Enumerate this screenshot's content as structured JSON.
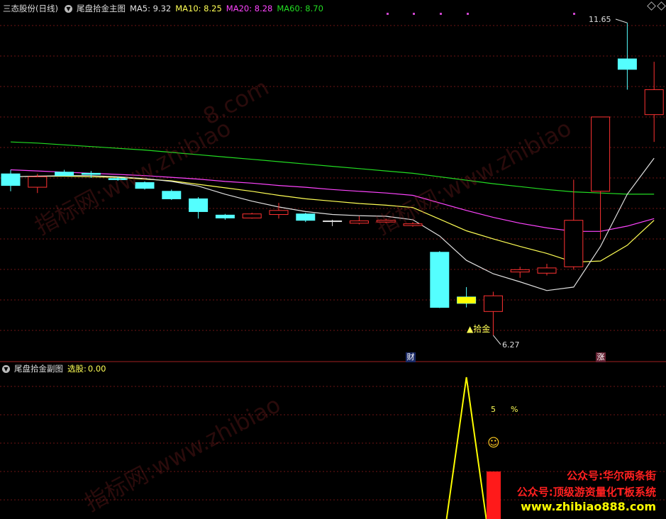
{
  "main_panel": {
    "stock_name": "三态股份",
    "period": "(日线)",
    "indicator_name": "尾盘拾金主图",
    "ma": [
      {
        "label": "MA5:",
        "value": "9.32",
        "color": "#e0e0e0"
      },
      {
        "label": "MA10:",
        "value": "8.25",
        "color": "#ffff55"
      },
      {
        "label": "MA20:",
        "value": "8.28",
        "color": "#ff44ff"
      },
      {
        "label": "MA60:",
        "value": "8.70",
        "color": "#22dd22"
      }
    ],
    "high_label": "11.65",
    "low_label": "6.27",
    "signal_label": "▲拾金",
    "event_markers": [
      "财",
      "涨"
    ]
  },
  "sub_panel": {
    "indicator_name": "尾盘拾金副图",
    "select_label": "选股:",
    "select_value": "0.00",
    "number_5": "5",
    "percent": "%",
    "smiley": "☺"
  },
  "watermark": {
    "cn": "指标网:",
    "url": "www.zhibiao",
    "url2": "8.com"
  },
  "promo": {
    "line1": "公众号:华尔两条街",
    "line2": "公众号:顶级游资量化T板系统",
    "line3": "www.zhibiao888.com"
  },
  "colors": {
    "up": "#ff3232",
    "down": "#54ffff",
    "flat": "#e0e0e0",
    "ma5": "#e0e0e0",
    "ma10": "#ffff55",
    "ma20": "#ff44ff",
    "ma60": "#22dd22",
    "grid": "#6e1515",
    "promo_red": "#ff2020",
    "promo_yellow": "#ffff00"
  },
  "chart_data": {
    "type": "candlestick",
    "candles": [
      {
        "o": 9.05,
        "h": 9.12,
        "l": 8.75,
        "c": 8.85
      },
      {
        "o": 8.82,
        "h": 9.05,
        "l": 8.72,
        "c": 9.0
      },
      {
        "o": 9.08,
        "h": 9.12,
        "l": 9.02,
        "c": 9.02
      },
      {
        "o": 9.06,
        "h": 9.1,
        "l": 8.98,
        "c": 9.04
      },
      {
        "o": 8.97,
        "h": 9.0,
        "l": 8.93,
        "c": 8.95
      },
      {
        "o": 8.9,
        "h": 8.92,
        "l": 8.78,
        "c": 8.8
      },
      {
        "o": 8.75,
        "h": 8.78,
        "l": 8.6,
        "c": 8.62
      },
      {
        "o": 8.62,
        "h": 8.65,
        "l": 8.28,
        "c": 8.4
      },
      {
        "o": 8.34,
        "h": 8.36,
        "l": 8.26,
        "c": 8.29
      },
      {
        "o": 8.29,
        "h": 8.38,
        "l": 8.28,
        "c": 8.36
      },
      {
        "o": 8.35,
        "h": 8.55,
        "l": 8.28,
        "c": 8.42
      },
      {
        "o": 8.36,
        "h": 8.38,
        "l": 8.22,
        "c": 8.25
      },
      {
        "o": 8.24,
        "h": 8.26,
        "l": 8.15,
        "c": 8.24
      },
      {
        "o": 8.2,
        "h": 8.32,
        "l": 8.18,
        "c": 8.24
      },
      {
        "o": 8.22,
        "h": 8.28,
        "l": 8.2,
        "c": 8.25
      },
      {
        "o": 8.16,
        "h": 8.22,
        "l": 8.14,
        "c": 8.19
      },
      {
        "o": 7.7,
        "h": 7.72,
        "l": 6.74,
        "c": 6.75
      },
      {
        "o": 6.93,
        "h": 7.1,
        "l": 6.75,
        "c": 6.82
      },
      {
        "o": 6.68,
        "h": 7.02,
        "l": 6.27,
        "c": 6.95
      },
      {
        "o": 7.36,
        "h": 7.45,
        "l": 7.26,
        "c": 7.4
      },
      {
        "o": 7.34,
        "h": 7.5,
        "l": 7.3,
        "c": 7.43
      },
      {
        "o": 7.45,
        "h": 8.95,
        "l": 7.4,
        "c": 8.25
      },
      {
        "o": 8.75,
        "h": 10.03,
        "l": 7.92,
        "c": 10.03
      },
      {
        "o": 11.03,
        "h": 11.65,
        "l": 10.5,
        "c": 10.85
      },
      {
        "o": 10.07,
        "h": 10.98,
        "l": 9.6,
        "c": 10.5
      }
    ],
    "ma5": [
      9.0,
      9.01,
      9.02,
      9.02,
      9.0,
      8.97,
      8.92,
      8.84,
      8.7,
      8.58,
      8.48,
      8.4,
      8.35,
      8.33,
      8.32,
      8.26,
      7.98,
      7.56,
      7.33,
      7.19,
      7.04,
      7.1,
      7.8,
      8.7,
      9.32
    ],
    "ma10": [
      9.0,
      9.01,
      9.01,
      9.0,
      8.99,
      8.96,
      8.93,
      8.87,
      8.81,
      8.75,
      8.68,
      8.62,
      8.58,
      8.54,
      8.51,
      8.47,
      8.27,
      8.07,
      7.93,
      7.8,
      7.68,
      7.53,
      7.55,
      7.82,
      8.25
    ],
    "ma20": [
      9.12,
      9.1,
      9.08,
      9.06,
      9.04,
      9.02,
      8.99,
      8.96,
      8.92,
      8.89,
      8.85,
      8.82,
      8.78,
      8.75,
      8.72,
      8.68,
      8.55,
      8.42,
      8.3,
      8.2,
      8.12,
      8.06,
      8.06,
      8.15,
      8.28
    ],
    "ma60": [
      9.6,
      9.58,
      9.55,
      9.52,
      9.49,
      9.46,
      9.42,
      9.38,
      9.34,
      9.3,
      9.26,
      9.22,
      9.18,
      9.14,
      9.1,
      9.06,
      9.0,
      8.94,
      8.88,
      8.83,
      8.78,
      8.74,
      8.72,
      8.7,
      8.7
    ],
    "sub_series": [
      0,
      0,
      0,
      0,
      0,
      0,
      0,
      0,
      0,
      0,
      0,
      0,
      0,
      0,
      0,
      0,
      0,
      100,
      0,
      0,
      0,
      0,
      0,
      0,
      0
    ],
    "event_marker_candles": [
      16,
      22
    ]
  }
}
